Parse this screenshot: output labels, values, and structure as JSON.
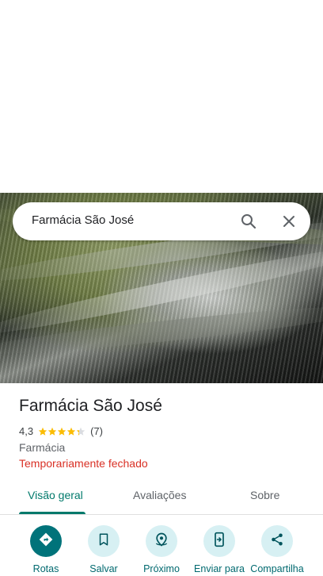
{
  "search": {
    "query": "Farmácia São José"
  },
  "place": {
    "name": "Farmácia São José",
    "rating": "4,3",
    "rating_value": 4.3,
    "review_count": "(7)",
    "category": "Farmácia",
    "status": "Temporariamente fechado"
  },
  "tabs": [
    {
      "label": "Visão geral",
      "active": true
    },
    {
      "label": "Avaliações",
      "active": false
    },
    {
      "label": "Sobre",
      "active": false
    }
  ],
  "actions": [
    {
      "label": "Rotas",
      "icon": "directions-icon"
    },
    {
      "label": "Salvar",
      "icon": "bookmark-icon"
    },
    {
      "label": "Próximo",
      "icon": "nearby-icon"
    },
    {
      "label": "Enviar para",
      "icon": "send-to-phone-icon"
    },
    {
      "label": "Compartilha",
      "icon": "share-icon"
    }
  ],
  "colors": {
    "accent": "#00796b",
    "status_closed": "#d93025",
    "star": "#fbbc04",
    "action_bg": "#d7f0f3",
    "action_primary_bg": "#00737a"
  }
}
